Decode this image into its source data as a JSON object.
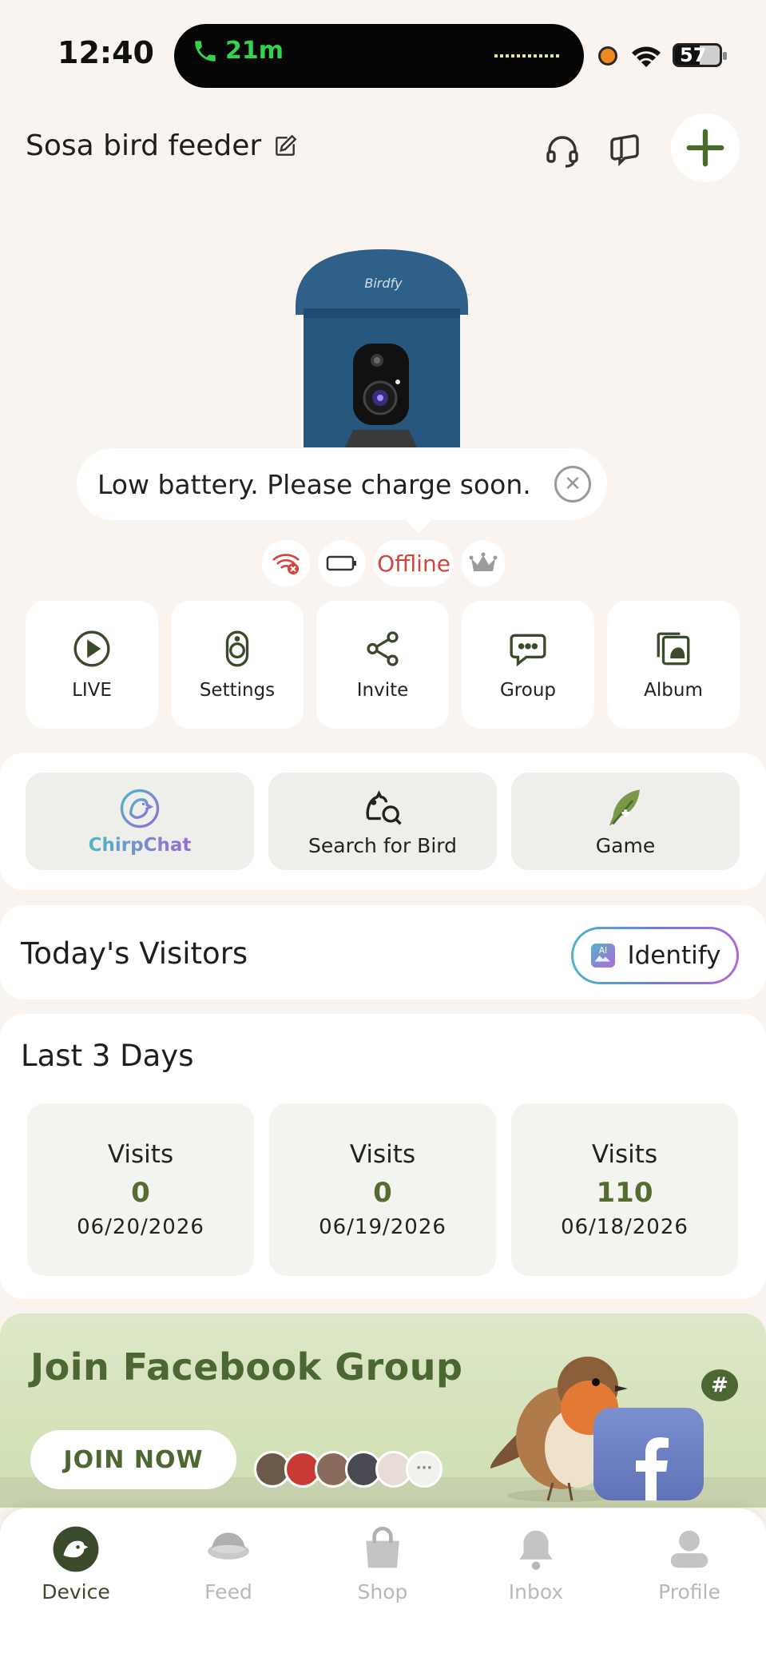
{
  "status_bar": {
    "time": "12:40",
    "call_duration": "21m",
    "battery_level": "57"
  },
  "header": {
    "device_name": "Sosa bird feeder"
  },
  "device": {
    "brand_mark": "Birdfy"
  },
  "tooltip": {
    "message": "Low battery. Please charge soon."
  },
  "status": {
    "connection_label": "Offline"
  },
  "actions": [
    {
      "label": "LIVE"
    },
    {
      "label": "Settings"
    },
    {
      "label": "Invite"
    },
    {
      "label": "Group"
    },
    {
      "label": "Album"
    }
  ],
  "features": [
    {
      "label": "ChirpChat"
    },
    {
      "label": "Search for Bird"
    },
    {
      "label": "Game"
    }
  ],
  "today": {
    "title": "Today's Visitors",
    "identify_label": "Identify"
  },
  "last_days": {
    "title": "Last 3 Days",
    "days": [
      {
        "label": "Visits",
        "count": "0",
        "date": "06/20/2026"
      },
      {
        "label": "Visits",
        "count": "0",
        "date": "06/19/2026"
      },
      {
        "label": "Visits",
        "count": "110",
        "date": "06/18/2026"
      }
    ]
  },
  "banner": {
    "title": "Join Facebook Group",
    "button": "JOIN NOW",
    "more": "···"
  },
  "nav": [
    {
      "label": "Device"
    },
    {
      "label": "Feed"
    },
    {
      "label": "Shop"
    },
    {
      "label": "Inbox"
    },
    {
      "label": "Profile"
    }
  ],
  "colors": {
    "accent": "#556b2f",
    "offline": "#d0453c",
    "background": "#f9f4f0",
    "device_blue": "#2e5e86"
  }
}
